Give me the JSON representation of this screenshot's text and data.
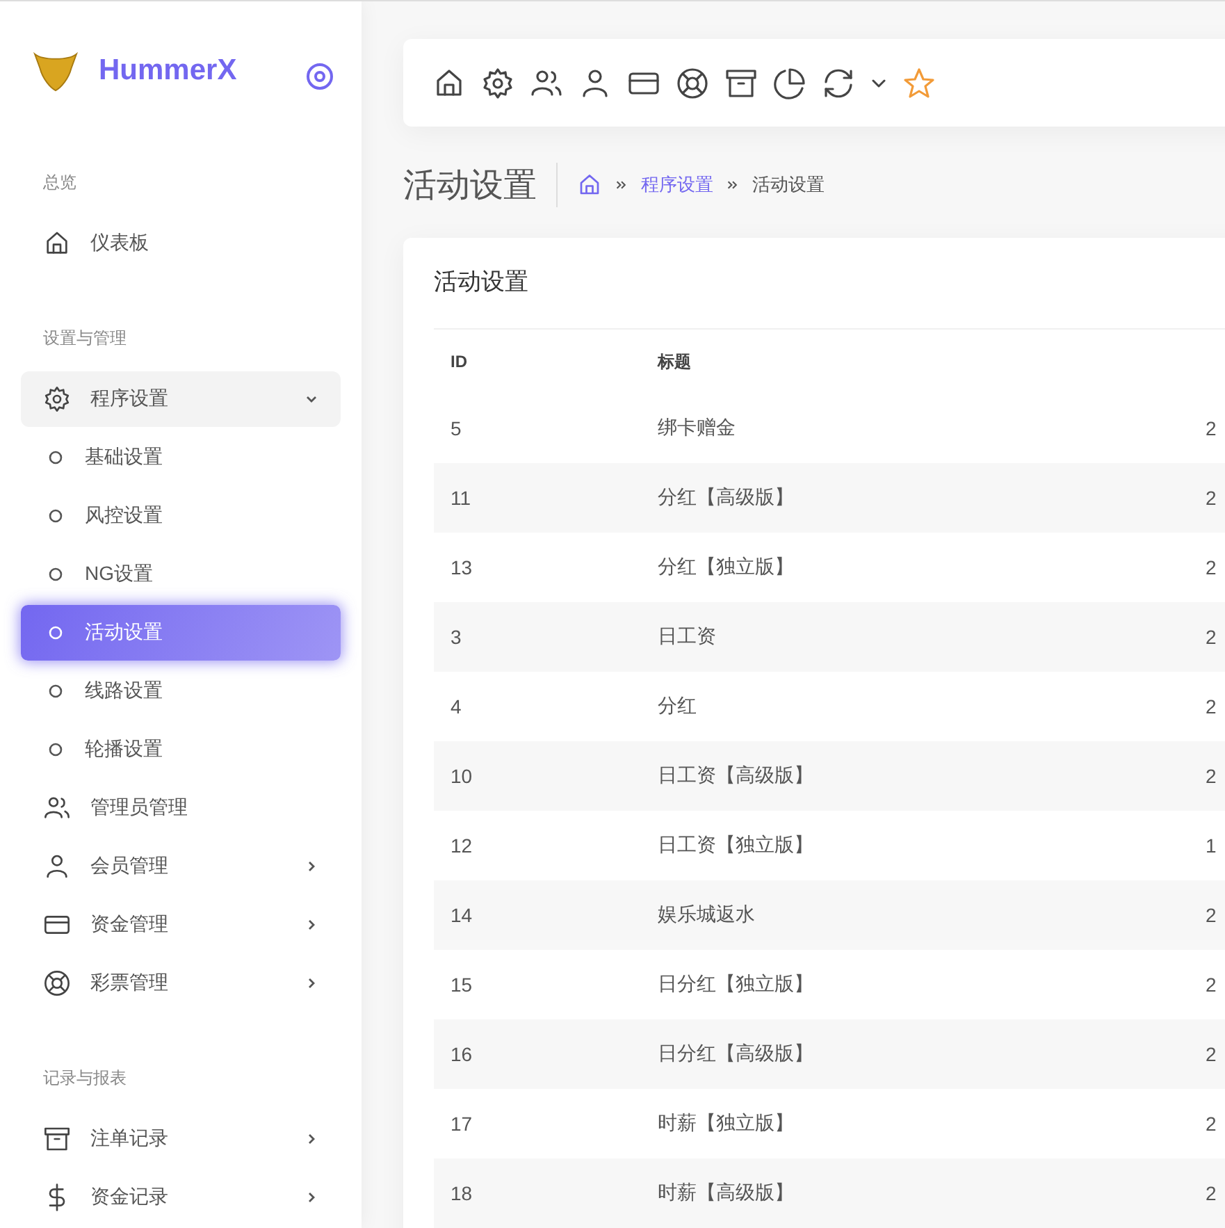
{
  "sidebar": {
    "brand": "HummerX",
    "groups": [
      {
        "title": "总览",
        "items": [
          {
            "kind": "home",
            "label": "仪表板",
            "expandable": false
          }
        ]
      },
      {
        "title": "设置与管理",
        "items": [
          {
            "kind": "gear",
            "label": "程序设置",
            "expandable": true,
            "expanded": true,
            "children": [
              {
                "label": "基础设置",
                "selected": false
              },
              {
                "label": "风控设置",
                "selected": false
              },
              {
                "label": "NG设置",
                "selected": false
              },
              {
                "label": "活动设置",
                "selected": true
              },
              {
                "label": "线路设置",
                "selected": false
              },
              {
                "label": "轮播设置",
                "selected": false
              }
            ]
          },
          {
            "kind": "users",
            "label": "管理员管理",
            "expandable": false
          },
          {
            "kind": "user",
            "label": "会员管理",
            "expandable": true,
            "expanded": false
          },
          {
            "kind": "card",
            "label": "资金管理",
            "expandable": true,
            "expanded": false
          },
          {
            "kind": "lifebuoy",
            "label": "彩票管理",
            "expandable": true,
            "expanded": false
          }
        ]
      },
      {
        "title": "记录与报表",
        "items": [
          {
            "kind": "archive",
            "label": "注单记录",
            "expandable": true,
            "expanded": false
          },
          {
            "kind": "dollar",
            "label": "资金记录",
            "expandable": true,
            "expanded": false
          }
        ]
      }
    ]
  },
  "toolbar": {
    "icons": [
      {
        "kind": "home"
      },
      {
        "kind": "gear"
      },
      {
        "kind": "users"
      },
      {
        "kind": "user"
      },
      {
        "kind": "card"
      },
      {
        "kind": "lifebuoy"
      },
      {
        "kind": "archive"
      },
      {
        "kind": "pie"
      },
      {
        "kind": "refresh"
      },
      {
        "kind": "caret"
      },
      {
        "kind": "star"
      }
    ]
  },
  "page_title": "活动设置",
  "breadcrumb": [
    {
      "label": "程序设置",
      "link": true
    },
    {
      "label": "活动设置",
      "link": false
    }
  ],
  "card": {
    "title": "活动设置",
    "table": {
      "columns": [
        "ID",
        "标题"
      ],
      "rows": [
        [
          "5",
          "绑卡赠金",
          "2"
        ],
        [
          "11",
          "分红【高级版】",
          "2"
        ],
        [
          "13",
          "分红【独立版】",
          "2"
        ],
        [
          "3",
          "日工资",
          "2"
        ],
        [
          "4",
          "分红",
          "2"
        ],
        [
          "10",
          "日工资【高级版】",
          "2"
        ],
        [
          "12",
          "日工资【独立版】",
          "1"
        ],
        [
          "14",
          "娱乐城返水",
          "2"
        ],
        [
          "15",
          "日分红【独立版】",
          "2"
        ],
        [
          "16",
          "日分红【高级版】",
          "2"
        ],
        [
          "17",
          "时薪【独立版】",
          "2"
        ],
        [
          "18",
          "时薪【高级版】",
          "2"
        ]
      ]
    }
  }
}
